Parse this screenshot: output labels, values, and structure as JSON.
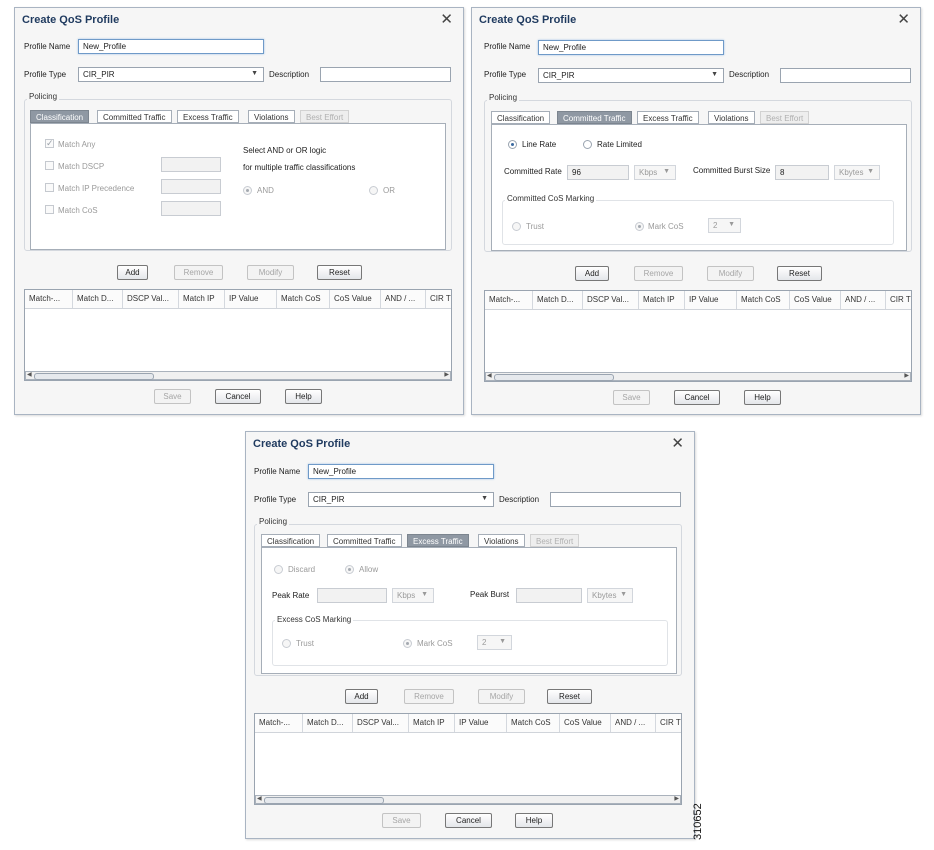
{
  "dialogs": [
    {
      "title": "Create QoS Profile",
      "profile_name_label": "Profile Name",
      "profile_name_value": "New_Profile",
      "profile_type_label": "Profile Type",
      "profile_type_value": "CIR_PIR",
      "description_label": "Description",
      "description_value": "",
      "policing_label": "Policing",
      "tabs": [
        "Classification",
        "Committed Traffic",
        "Excess Traffic",
        "Violations",
        "Best Effort"
      ],
      "active_tab": "Classification",
      "classification": {
        "match_any": "Match Any",
        "match_dscp": "Match DSCP",
        "match_ip_precedence": "Match IP Precedence",
        "match_cos": "Match CoS",
        "logic_text_1": "Select AND or OR logic",
        "logic_text_2": "for multiple traffic classifications",
        "and_label": "AND",
        "or_label": "OR"
      },
      "buttons": {
        "add": "Add",
        "remove": "Remove",
        "modify": "Modify",
        "reset": "Reset"
      },
      "columns": [
        "Match-...",
        "Match D...",
        "DSCP Val...",
        "Match IP",
        "IP Value",
        "Match CoS",
        "CoS Value",
        "AND / ...",
        "CIR T"
      ],
      "footer": {
        "save": "Save",
        "cancel": "Cancel",
        "help": "Help"
      }
    },
    {
      "title": "Create QoS Profile",
      "profile_name_label": "Profile Name",
      "profile_name_value": "New_Profile",
      "profile_type_label": "Profile Type",
      "profile_type_value": "CIR_PIR",
      "description_label": "Description",
      "description_value": "",
      "policing_label": "Policing",
      "tabs": [
        "Classification",
        "Committed Traffic",
        "Excess Traffic",
        "Violations",
        "Best Effort"
      ],
      "active_tab": "Committed Traffic",
      "committed": {
        "line_rate": "Line Rate",
        "rate_limited": "Rate Limited",
        "committed_rate_label": "Committed Rate",
        "committed_rate_value": "96",
        "rate_unit": "Kbps",
        "burst_label": "Committed Burst Size",
        "burst_value": "8",
        "burst_unit": "Kbytes",
        "marking_label": "Committed CoS Marking",
        "trust": "Trust",
        "mark_cos": "Mark CoS",
        "cos_value": "2"
      },
      "buttons": {
        "add": "Add",
        "remove": "Remove",
        "modify": "Modify",
        "reset": "Reset"
      },
      "columns": [
        "Match-...",
        "Match D...",
        "DSCP Val...",
        "Match IP",
        "IP Value",
        "Match CoS",
        "CoS Value",
        "AND / ...",
        "CIR T"
      ],
      "footer": {
        "save": "Save",
        "cancel": "Cancel",
        "help": "Help"
      }
    },
    {
      "title": "Create QoS Profile",
      "profile_name_label": "Profile Name",
      "profile_name_value": "New_Profile",
      "profile_type_label": "Profile Type",
      "profile_type_value": "CIR_PIR",
      "description_label": "Description",
      "description_value": "",
      "policing_label": "Policing",
      "tabs": [
        "Classification",
        "Committed Traffic",
        "Excess Traffic",
        "Violations",
        "Best Effort"
      ],
      "active_tab": "Excess Traffic",
      "excess": {
        "discard": "Discard",
        "allow": "Allow",
        "peak_rate_label": "Peak Rate",
        "peak_rate_value": "",
        "rate_unit": "Kbps",
        "peak_burst_label": "Peak Burst",
        "peak_burst_value": "",
        "burst_unit": "Kbytes",
        "marking_label": "Excess CoS Marking",
        "trust": "Trust",
        "mark_cos": "Mark CoS",
        "cos_value": "2"
      },
      "buttons": {
        "add": "Add",
        "remove": "Remove",
        "modify": "Modify",
        "reset": "Reset"
      },
      "columns": [
        "Match-...",
        "Match D...",
        "DSCP Val...",
        "Match IP",
        "IP Value",
        "Match CoS",
        "CoS Value",
        "AND / ...",
        "CIR T"
      ],
      "footer": {
        "save": "Save",
        "cancel": "Cancel",
        "help": "Help"
      }
    }
  ],
  "figure_number": "310652",
  "icons": {
    "close": "close-icon",
    "dropdown": "chevron-down-icon",
    "scroll_left": "arrow-left-icon",
    "scroll_right": "arrow-right-icon"
  }
}
